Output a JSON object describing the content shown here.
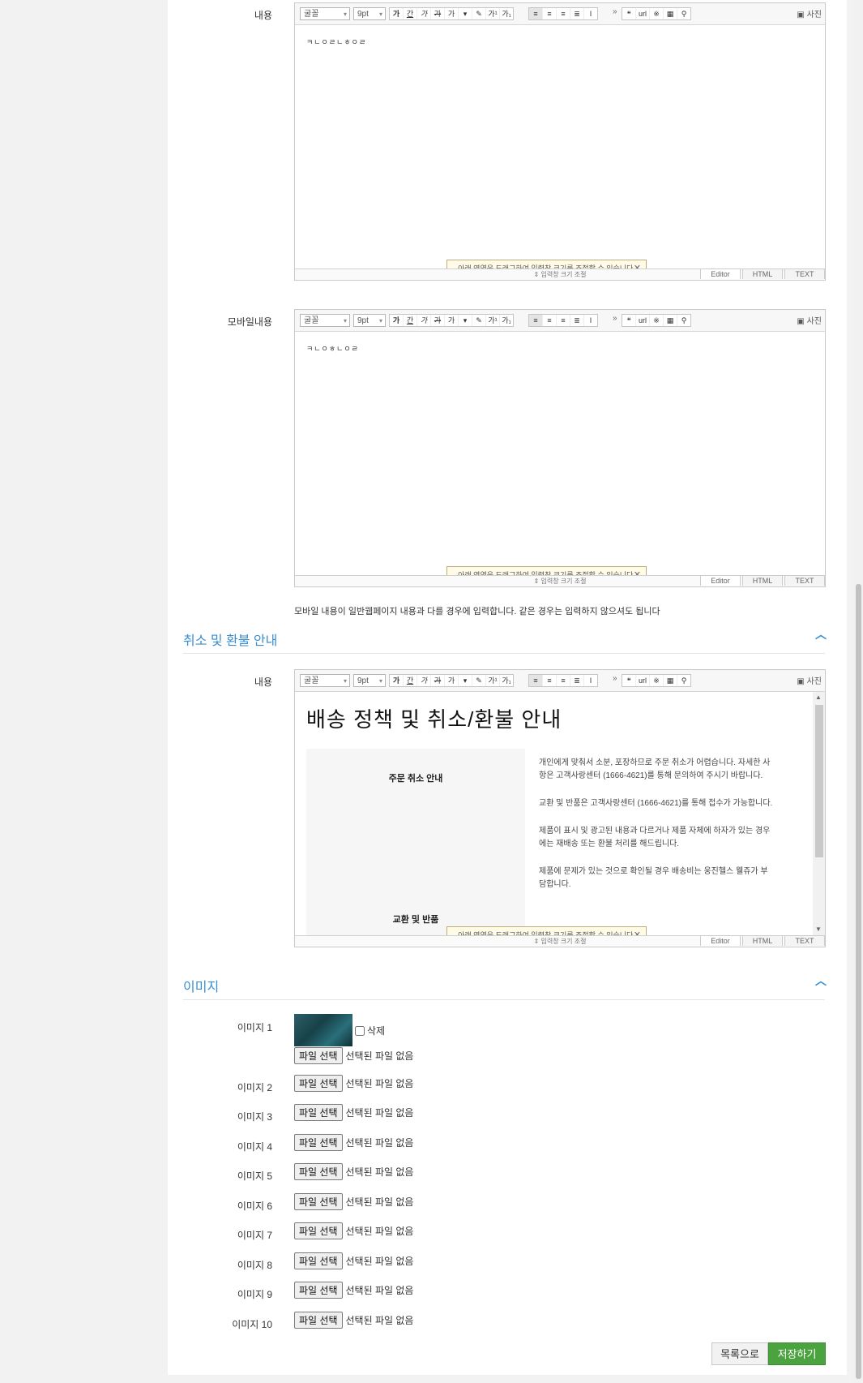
{
  "content_label": "내용",
  "mobile_label": "모바일내용",
  "editor": {
    "font": "굴꼴",
    "size": "9pt",
    "photo": "사진",
    "resize_tip": "아래 영역을 드래그하여 입력창 크기를 조절할 수 있습니다.",
    "resize_label": "⇕ 입력창 크기 조절",
    "tab_editor": "Editor",
    "tab_html": "HTML",
    "tab_text": "TEXT"
  },
  "content_text": "ㅋㄴㅇㄹㄴㅎㅇㄹ",
  "mobile_text": "ㅋㄴㅇㅎㄴㅇㄹ",
  "mobile_note": "모바일 내용이 일반웹페이지 내용과 다를 경우에 입력합니다. 같은 경우는 입력하지 않으셔도 됩니다",
  "refund_section": "취소 및 환불 안내",
  "refund_label": "내용",
  "refund_doc": {
    "title": "배송 정책 및 취소/환불 안내",
    "left_head1": "주문 취소 안내",
    "left_head2": "교환 및 반품",
    "p1": "개인에게 맞춰서 소분, 포장하므로 주문 취소가 어렵습니다. 자세한 사항은 고객사랑센터 (1666-4621)를 통해 문의하여 주시기 바랍니다.",
    "p2": "교환 및 반품은 고객사랑센터 (1666-4621)를 통해 접수가 가능합니다.",
    "p3": "제품이 표시 및 광고된 내용과 다르거나 제품 자체에 하자가 있는 경우에는 재배송 또는 환불 처리를 해드립니다.",
    "p4": "제품에 문제가 있는 것으로 확인될 경우 배송비는 웅진헬스 웰쥬가 부담합니다."
  },
  "image_section": "이미지",
  "images": [
    {
      "label": "이미지 1"
    },
    {
      "label": "이미지 2"
    },
    {
      "label": "이미지 3"
    },
    {
      "label": "이미지 4"
    },
    {
      "label": "이미지 5"
    },
    {
      "label": "이미지 6"
    },
    {
      "label": "이미지 7"
    },
    {
      "label": "이미지 8"
    },
    {
      "label": "이미지 9"
    },
    {
      "label": "이미지 10"
    }
  ],
  "delete_label": "삭제",
  "file_button": "파일 선택",
  "file_none": "선택된 파일 없음",
  "list_button": "목록으로",
  "save_button": "저장하기"
}
